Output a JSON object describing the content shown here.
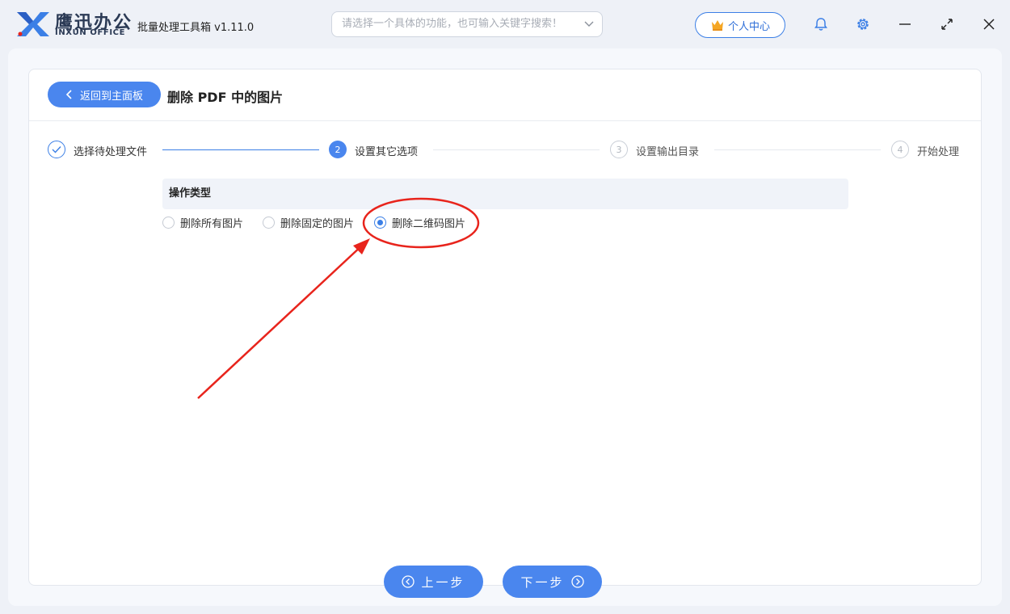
{
  "app": {
    "brand_cn": "鹰迅办公",
    "brand_en": "INXUN OFFICE",
    "title": "批量处理工具箱 v1.11.0"
  },
  "search": {
    "placeholder": "请选择一个具体的功能，也可输入关键字搜索！"
  },
  "header": {
    "user_center_label": "个人中心",
    "icons": [
      "crown-icon",
      "bell-icon",
      "gear-icon",
      "minimize-icon",
      "maximize-icon",
      "close-icon"
    ]
  },
  "page": {
    "back_label": "返回到主面板",
    "title": "删除 PDF 中的图片"
  },
  "steps": [
    {
      "number": "1",
      "label": "选择待处理文件",
      "state": "done"
    },
    {
      "number": "2",
      "label": "设置其它选项",
      "state": "active"
    },
    {
      "number": "3",
      "label": "设置输出目录",
      "state": "pending"
    },
    {
      "number": "4",
      "label": "开始处理",
      "state": "pending"
    }
  ],
  "options": {
    "header": "操作类型",
    "items": [
      {
        "label": "删除所有图片",
        "selected": false
      },
      {
        "label": "删除固定的图片",
        "selected": false
      },
      {
        "label": "删除二维码图片",
        "selected": true
      }
    ]
  },
  "footer": {
    "prev_label": "上一步",
    "next_label": "下一步"
  },
  "colors": {
    "accent": "#4a86ee",
    "annotation": "#e8241c"
  }
}
